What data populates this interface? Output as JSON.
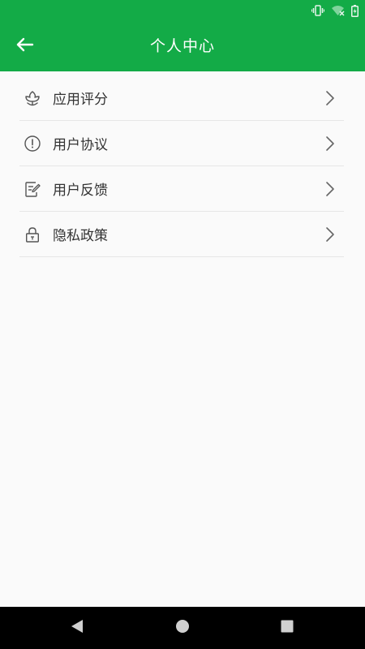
{
  "app_bar": {
    "title": "个人中心",
    "back_icon": "arrow-left-icon",
    "background_color": "#13ab47"
  },
  "status_bar": {
    "icons": [
      "vibrate-icon",
      "wifi-off-icon",
      "battery-charging-icon"
    ]
  },
  "menu": {
    "items": [
      {
        "label": "应用评分",
        "icon": "flower-rating-icon"
      },
      {
        "label": "用户协议",
        "icon": "exclamation-circle-icon"
      },
      {
        "label": "用户反馈",
        "icon": "edit-note-icon"
      },
      {
        "label": "隐私政策",
        "icon": "lock-icon"
      }
    ],
    "chevron_icon": "chevron-right-icon"
  },
  "nav_bar": {
    "buttons": [
      "back-triangle-icon",
      "home-circle-icon",
      "recents-square-icon"
    ]
  }
}
